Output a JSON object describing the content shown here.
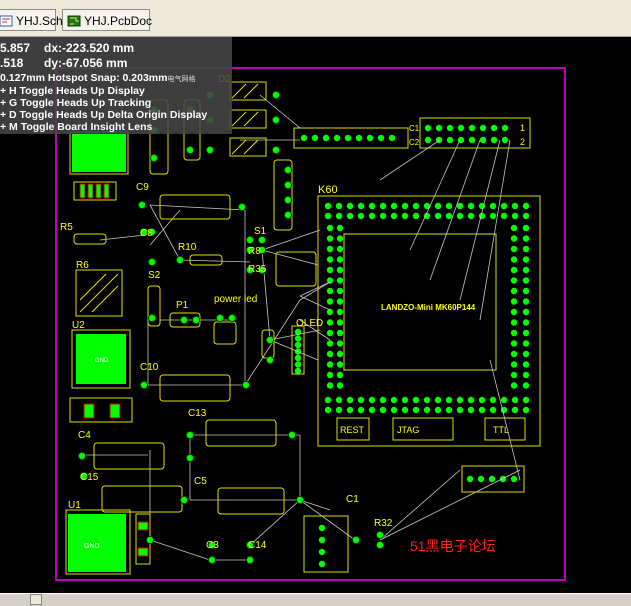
{
  "tabs": [
    {
      "label": "YHJ.SchDoc",
      "icon": "schematic-document-icon"
    },
    {
      "label": "YHJ.PcbDoc",
      "icon": "pcb-document-icon"
    }
  ],
  "hud": {
    "x_value": "5.857",
    "dx_value": "dx:-223.520  mm",
    "y_value": ".518",
    "dy_value": "dy:-67.056  mm",
    "snap": "0.127mm Hotspot Snap: 0.203mm",
    "snap_suffix": "电气网格",
    "shortcuts": [
      "+ H  Toggle Heads Up Display",
      "+ G  Toggle Heads Up Tracking",
      "+ D  Toggle Heads Up Delta Origin Display",
      "+ M  Toggle Board Insight Lens"
    ]
  },
  "board": {
    "watermark": "51黑电子论坛",
    "module_title": "LANDZO-Mini MK60P144",
    "module_label": "K60",
    "header_pins": [
      "1",
      "2"
    ],
    "header_rows": [
      "C1",
      "C2"
    ],
    "buttons": [
      "REST",
      "JTAG",
      "TTL"
    ],
    "designators": [
      "D2",
      "C9",
      "R5",
      "C8",
      "R10",
      "S1",
      "R8",
      "R35",
      "R6",
      "S2",
      "P1",
      "power led",
      "U2",
      "OLED",
      "C10",
      "C13",
      "C4",
      "C15",
      "C5",
      "U1",
      "C1",
      "C3",
      "C14",
      "R32"
    ],
    "pad_labels": [
      "GND"
    ],
    "colors": {
      "background": "#000000",
      "silk": "#ffff00",
      "pad": "#00ff00",
      "track": "#c0c0c0",
      "outline": "#ff00ff",
      "watermark": "#ff2020"
    }
  }
}
